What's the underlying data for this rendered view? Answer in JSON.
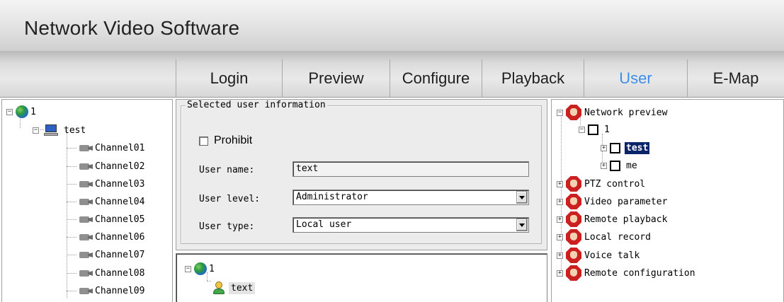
{
  "app": {
    "title": "Network Video Software"
  },
  "nav": {
    "tabs": [
      {
        "label": "Login"
      },
      {
        "label": "Preview"
      },
      {
        "label": "Configure"
      },
      {
        "label": "Playback"
      },
      {
        "label": "User"
      },
      {
        "label": "E-Map"
      }
    ],
    "active": "User"
  },
  "device_tree": {
    "root": "1",
    "device": "test",
    "channels": [
      "Channel01",
      "Channel02",
      "Channel03",
      "Channel04",
      "Channel05",
      "Channel06",
      "Channel07",
      "Channel08",
      "Channel09"
    ]
  },
  "user_info": {
    "legend": "Selected user information",
    "prohibit_label": "Prohibit",
    "username_label": "User name:",
    "username_value": "text",
    "level_label": "User level:",
    "level_value": "Administrator",
    "type_label": "User type:",
    "type_value": "Local user"
  },
  "user_tree": {
    "root": "1",
    "user": "text"
  },
  "permissions": {
    "network_preview": "Network preview",
    "group": "1",
    "items": [
      "test",
      "me"
    ],
    "others": [
      "PTZ control",
      "Video parameter",
      "Remote playback",
      "Local record",
      "Voice talk",
      "Remote configuration"
    ]
  },
  "colors": {
    "active_tab": "#3f8fe8",
    "selection": "#0a246a"
  }
}
